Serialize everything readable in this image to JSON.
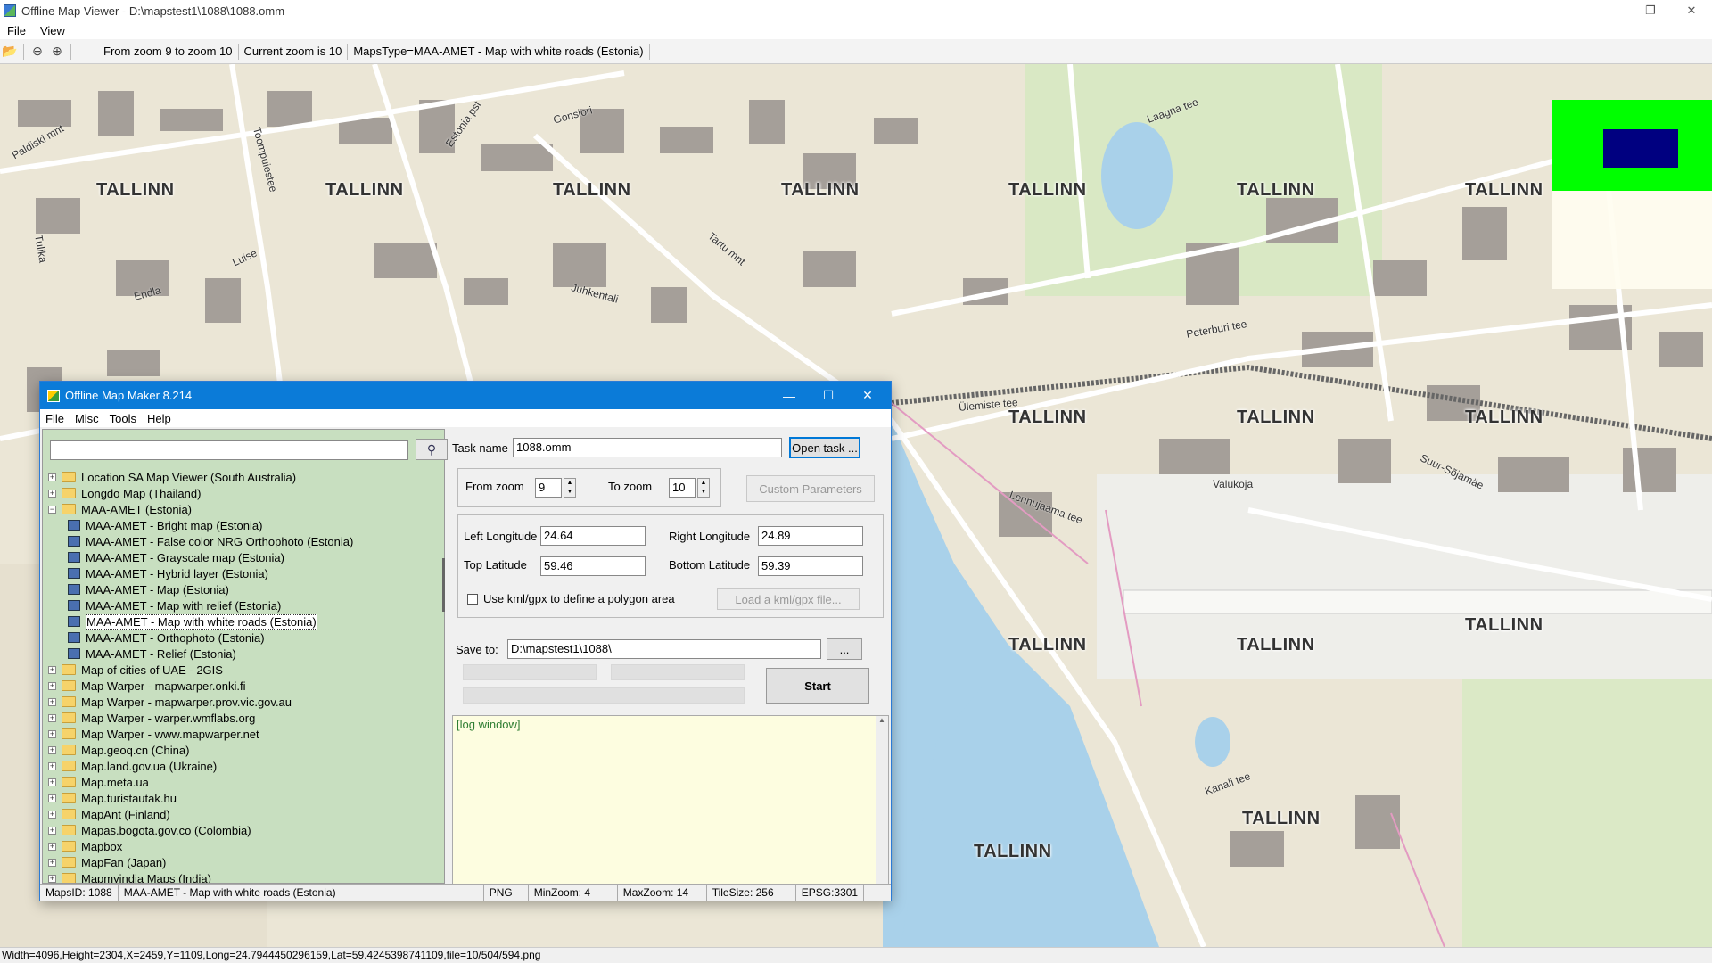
{
  "window": {
    "title": "Offline Map Viewer - D:\\mapstest1\\1088\\1088.omm",
    "controls": {
      "minimize": "—",
      "restore": "❐",
      "close": "✕"
    }
  },
  "menu": {
    "file": "File",
    "view": "View"
  },
  "toolbar": {
    "zoom_range": "From zoom 9 to zoom 10",
    "current_zoom": "Current zoom is 10",
    "maps_type": "MapsType=MAA-AMET - Map with white roads (Estonia)"
  },
  "map": {
    "labels": [
      "TALLINN",
      "TALLINN",
      "TALLINN",
      "TALLINN",
      "TALLINN",
      "TALLINN",
      "TALLINN",
      "TALLINN",
      "TALLINN",
      "TALLINN",
      "TALLINN",
      "TALLINN",
      "TALLINN",
      "TALLINN",
      "TALLINN"
    ],
    "streets": [
      "Paldiski mnt",
      "Toompuiestee",
      "Estonia pst",
      "Gonsiori",
      "Laagna tee",
      "Tartu mnt",
      "Juhkentali",
      "Peterburi tee",
      "Ülemiste tee",
      "Suur-Sõjamäe",
      "Valukoja",
      "Lennujaama tee",
      "Endla",
      "Luise",
      "Tulika",
      "Kanali tee"
    ]
  },
  "statusbar": {
    "text": "Width=4096,Height=2304,X=2459,Y=1109,Long=24.7944450296159,Lat=59.4245398741109,file=10/504/594.png"
  },
  "dialog": {
    "title": "Offline Map Maker 8.214",
    "menu": {
      "file": "File",
      "misc": "Misc",
      "tools": "Tools",
      "help": "Help"
    },
    "search_icon": "search-icon",
    "tree": [
      {
        "label": "Location SA Map Viewer (South Australia)",
        "exp": "+",
        "type": "folder"
      },
      {
        "label": "Longdo Map (Thailand)",
        "exp": "+",
        "type": "folder"
      },
      {
        "label": "MAA-AMET (Estonia)",
        "exp": "−",
        "type": "folder"
      },
      {
        "label": "MAA-AMET - Bright map (Estonia)",
        "type": "map"
      },
      {
        "label": "MAA-AMET - False color NRG Orthophoto (Estonia)",
        "type": "map"
      },
      {
        "label": "MAA-AMET - Grayscale map (Estonia)",
        "type": "map"
      },
      {
        "label": "MAA-AMET - Hybrid layer (Estonia)",
        "type": "map"
      },
      {
        "label": "MAA-AMET - Map (Estonia)",
        "type": "map"
      },
      {
        "label": "MAA-AMET - Map with relief (Estonia)",
        "type": "map"
      },
      {
        "label": "MAA-AMET - Map with white roads (Estonia)",
        "type": "map",
        "selected": true
      },
      {
        "label": "MAA-AMET - Orthophoto (Estonia)",
        "type": "map"
      },
      {
        "label": "MAA-AMET - Relief (Estonia)",
        "type": "map"
      },
      {
        "label": "Map of cities of UAE - 2GIS",
        "exp": "+",
        "type": "folder"
      },
      {
        "label": "Map Warper - mapwarper.onki.fi",
        "exp": "+",
        "type": "folder"
      },
      {
        "label": "Map Warper - mapwarper.prov.vic.gov.au",
        "exp": "+",
        "type": "folder"
      },
      {
        "label": "Map Warper - warper.wmflabs.org",
        "exp": "+",
        "type": "folder"
      },
      {
        "label": "Map Warper - www.mapwarper.net",
        "exp": "+",
        "type": "folder"
      },
      {
        "label": "Map.geoq.cn (China)",
        "exp": "+",
        "type": "folder"
      },
      {
        "label": "Map.land.gov.ua (Ukraine)",
        "exp": "+",
        "type": "folder"
      },
      {
        "label": "Map.meta.ua",
        "exp": "+",
        "type": "folder"
      },
      {
        "label": "Map.turistautak.hu",
        "exp": "+",
        "type": "folder"
      },
      {
        "label": "MapAnt (Finland)",
        "exp": "+",
        "type": "folder"
      },
      {
        "label": "Mapas.bogota.gov.co (Colombia)",
        "exp": "+",
        "type": "folder"
      },
      {
        "label": "Mapbox",
        "exp": "+",
        "type": "folder"
      },
      {
        "label": "MapFan (Japan)",
        "exp": "+",
        "type": "folder"
      },
      {
        "label": "Mapmyindia Maps (India)",
        "exp": "+",
        "type": "folder"
      }
    ],
    "form": {
      "task_name_label": "Task name",
      "task_name_value": "1088.omm",
      "open_task": "Open task ...",
      "from_zoom_label": "From zoom",
      "from_zoom_value": "9",
      "to_zoom_label": "To zoom",
      "to_zoom_value": "10",
      "custom_params": "Custom Parameters",
      "left_lon_label": "Left Longitude",
      "left_lon_value": "24.64",
      "right_lon_label": "Right Longitude",
      "right_lon_value": "24.89",
      "top_lat_label": "Top Latitude",
      "top_lat_value": "59.46",
      "bottom_lat_label": "Bottom Latitude",
      "bottom_lat_value": "59.39",
      "kml_label": "Use kml/gpx to define a polygon area",
      "load_kml": "Load a kml/gpx file...",
      "save_to_label": "Save to:",
      "save_to_value": "D:\\mapstest1\\1088\\",
      "browse": "...",
      "start": "Start",
      "log": "[log window]"
    },
    "status": {
      "maps_id": "MapsID: 1088",
      "maps_name": "MAA-AMET - Map with white roads (Estonia)",
      "format": "PNG",
      "min_zoom": "MinZoom: 4",
      "max_zoom": "MaxZoom: 14",
      "tile_size": "TileSize: 256",
      "epsg": "EPSG:3301"
    }
  }
}
